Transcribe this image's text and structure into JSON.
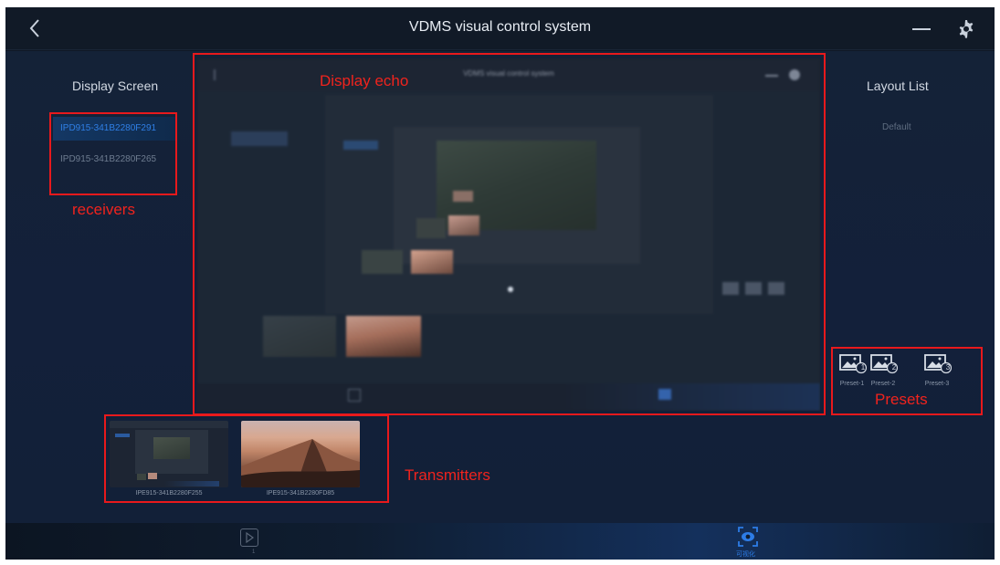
{
  "header": {
    "title": "VDMS visual control system"
  },
  "display_screen": {
    "title": "Display Screen",
    "receivers": [
      {
        "label": "IPD915-341B2280F291",
        "active": true
      },
      {
        "label": "IPD915-341B2280F265",
        "active": false
      }
    ]
  },
  "layout_list": {
    "title": "Layout List",
    "items": [
      "Default"
    ]
  },
  "echo": {
    "title": "VDMS visual control system"
  },
  "presets": [
    {
      "label": "Preset-1",
      "number": "1"
    },
    {
      "label": "Preset-2",
      "number": "2"
    },
    {
      "label": "Preset-3",
      "number": "3"
    }
  ],
  "transmitters": [
    {
      "label": "IPE915-341B2280F255"
    },
    {
      "label": "IPE915-341B2280FD85"
    }
  ],
  "annotations": {
    "display_echo": "Display echo",
    "receivers": "receivers",
    "presets": "Presets",
    "transmitters": "Transmitters"
  },
  "bottom_nav": {
    "play_count": "1",
    "visual_label": "可视化"
  },
  "colors": {
    "accent": "#2f7fe6",
    "annotation": "#e8191c",
    "background": "#13203a"
  }
}
